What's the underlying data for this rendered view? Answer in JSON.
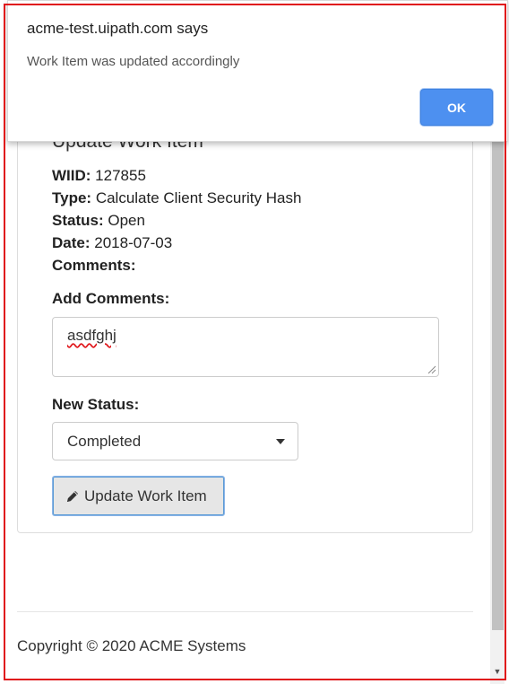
{
  "dialog": {
    "title": "acme-test.uipath.com says",
    "message": "Work Item was updated accordingly",
    "ok_label": "OK"
  },
  "panel": {
    "title": "Update Work Item",
    "fields": [
      {
        "label": "WIID:",
        "value": "127855"
      },
      {
        "label": "Type:",
        "value": "Calculate Client Security Hash"
      },
      {
        "label": "Status:",
        "value": "Open"
      },
      {
        "label": "Date:",
        "value": "2018-07-03"
      },
      {
        "label": "Comments:",
        "value": ""
      }
    ],
    "add_comments_label": "Add Comments:",
    "comment_value": "asdfghj",
    "new_status_label": "New Status:",
    "new_status_value": "Completed",
    "update_button_label": "Update Work Item"
  },
  "footer": {
    "copyright": "Copyright © 2020 ACME Systems"
  },
  "icons": {
    "pencil": "pencil-icon",
    "caret": "chevron-down-icon"
  },
  "colors": {
    "ok_button": "#4d90f0",
    "frame_border": "#e0161b"
  }
}
